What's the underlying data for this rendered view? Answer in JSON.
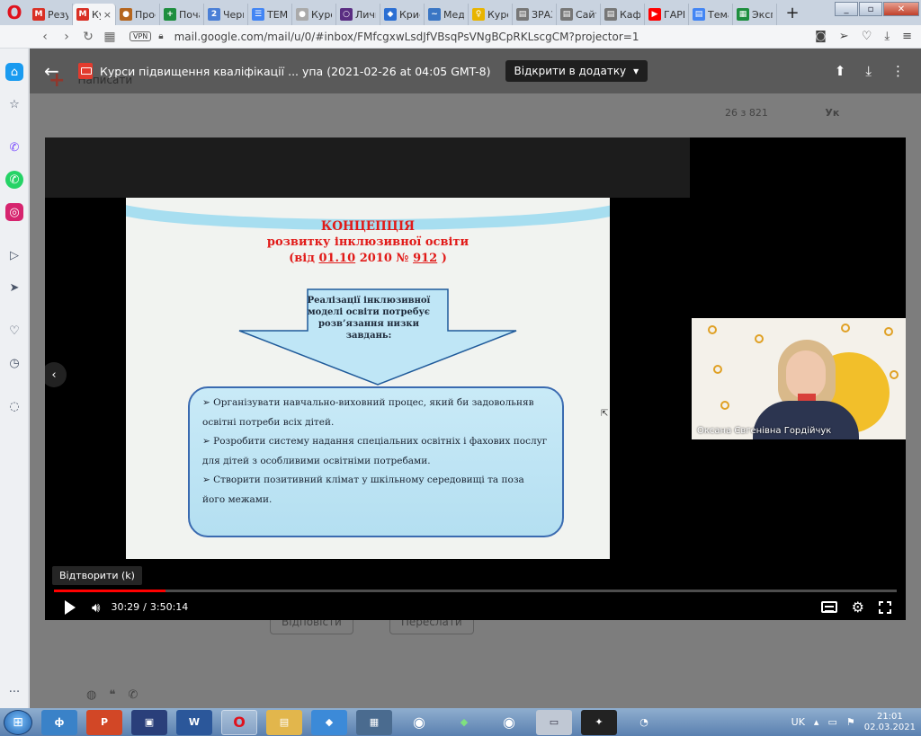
{
  "browser": {
    "tabs": [
      {
        "label": "Резу",
        "icon_letter": "M",
        "color": "#d93025"
      },
      {
        "label": "Ку",
        "icon_letter": "M",
        "color": "#d93025",
        "active": true
      },
      {
        "label": "Прос",
        "icon_letter": "●",
        "color": "#b5651d"
      },
      {
        "label": "Поча",
        "icon_letter": "+",
        "color": "#1e8e3e"
      },
      {
        "label": "Черн",
        "icon_letter": "2",
        "color": "#4a7fd6"
      },
      {
        "label": "ТЕМ",
        "icon_letter": "☰",
        "color": "#4285f4"
      },
      {
        "label": "Курс",
        "icon_letter": "●",
        "color": "#aaaaaa"
      },
      {
        "label": "Личн",
        "icon_letter": "○",
        "color": "#5a2d82"
      },
      {
        "label": "Крис",
        "icon_letter": "◆",
        "color": "#2b6fd3"
      },
      {
        "label": "Мед",
        "icon_letter": "~",
        "color": "#3a76c4"
      },
      {
        "label": "Курс",
        "icon_letter": "♀",
        "color": "#e8b400"
      },
      {
        "label": "ЗРАЗ",
        "icon_letter": "▤",
        "color": "#777777"
      },
      {
        "label": "Сайт",
        "icon_letter": "▤",
        "color": "#777777"
      },
      {
        "label": "Каф",
        "icon_letter": "▤",
        "color": "#777777"
      },
      {
        "label": "ГАРЕ",
        "icon_letter": "▶",
        "color": "#ff0000"
      },
      {
        "label": "Тема",
        "icon_letter": "▤",
        "color": "#4285f4"
      },
      {
        "label": "Эксп",
        "icon_letter": "▦",
        "color": "#1e8e3e"
      }
    ],
    "new_tab": "+",
    "url": "mail.google.com/mail/u/0/#inbox/FMfcgxwLsdJfVBsqPsVNgBCpRKLscgCM?projector=1",
    "vpn_label": "VPN"
  },
  "gmail": {
    "compose_label": "Написати",
    "pager": "26 з 821",
    "lang": "Ук",
    "reply_label": "Відповісти",
    "forward_label": "Переслати"
  },
  "viewer": {
    "title": "Курси підвищення кваліфікації ... упа (2021-02-26 at 04:05 GMT-8)",
    "open_with_label": "Відкрити в додатку"
  },
  "slide": {
    "title_line1": "КОНЦЕПЦІЯ",
    "title_line2": "розвитку інклюзивної освіти",
    "title_line3_prefix": "(від",
    "title_date": "01.10",
    "title_year_prefix": "2010 №",
    "title_number": "912",
    "title_close": ")",
    "arrow_text": "Реалізації інклюзивної моделі освіти потребує розв’язання низки завдань:",
    "tasks": [
      "➢ Організувати навчально-виховний процес, який би задовольняв освітні потреби всіх дітей.",
      "➢ Розробити систему надання спеціальних освітніх і фахових послуг для дітей з особливими освітніми потребами.",
      "➢ Створити позитивний клімат у шкільному середовищі та поза його межами."
    ]
  },
  "webcam": {
    "participant_name": "Оксана Євгенівна Гордійчук"
  },
  "player": {
    "tooltip": "Відтворити (k)",
    "current_time": "30:29",
    "separator": "/",
    "duration": "3:50:14",
    "progress_fraction": 0.1323
  },
  "taskbar": {
    "language": "UK",
    "time": "21:01",
    "date": "02.03.2021"
  },
  "colors": {
    "slide_title": "#e11a18",
    "progress": "#ff0000",
    "box_border": "#3a6ab0"
  }
}
